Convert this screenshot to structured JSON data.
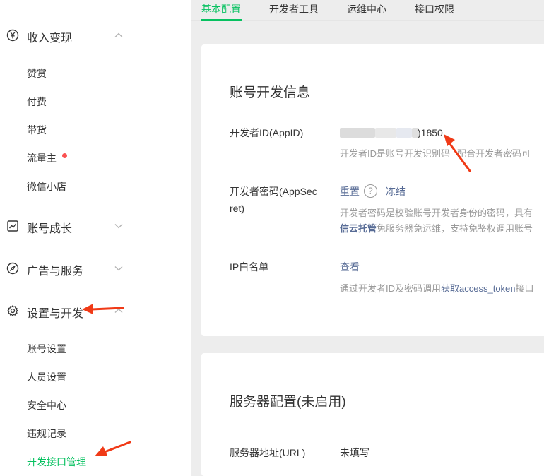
{
  "sidebar": {
    "income": {
      "label": "收入变现",
      "icon": "yen-circle-icon"
    },
    "income_items": [
      "赞赏",
      "付费",
      "带货",
      "流量主",
      "微信小店"
    ],
    "growth": {
      "label": "账号成长",
      "icon": "chart-trend-icon"
    },
    "ads": {
      "label": "广告与服务",
      "icon": "compass-icon"
    },
    "settings": {
      "label": "设置与开发",
      "icon": "gear-icon"
    },
    "settings_items": [
      "账号设置",
      "人员设置",
      "安全中心",
      "违规记录",
      "开发接口管理"
    ]
  },
  "tabs": [
    "基本配置",
    "开发者工具",
    "运维中心",
    "接口权限"
  ],
  "dev_info": {
    "title": "账号开发信息",
    "appid_label": "开发者ID(AppID)",
    "appid_suffix": ")1850",
    "appid_desc_a": "开发者ID是账号开发识别码",
    "appid_desc_b": "配合开发者密码可",
    "secret_label_1": "开发者密码(AppSec",
    "secret_label_2": "ret)",
    "reset_label": "重置",
    "help_icon_text": "?",
    "freeze_label": "冻结",
    "secret_desc_1": "开发者密码是校验账号开发者身份的密码，具有",
    "secret_desc_2_link": "信云托管",
    "secret_desc_2": "免服务器免运维，支持免鉴权调用账号",
    "ip_label": "IP白名单",
    "ip_view_label": "查看",
    "ip_desc_a": "通过开发者ID及密码调用",
    "ip_desc_link": "获取access_token",
    "ip_desc_b": "接口"
  },
  "server": {
    "title": "服务器配置(未启用)",
    "url_label": "服务器地址(URL)",
    "url_value": "未填写"
  },
  "colors": {
    "accent": "#07c160",
    "link": "#576b95",
    "arrow": "#f03a17",
    "dot": "#fa5151"
  }
}
